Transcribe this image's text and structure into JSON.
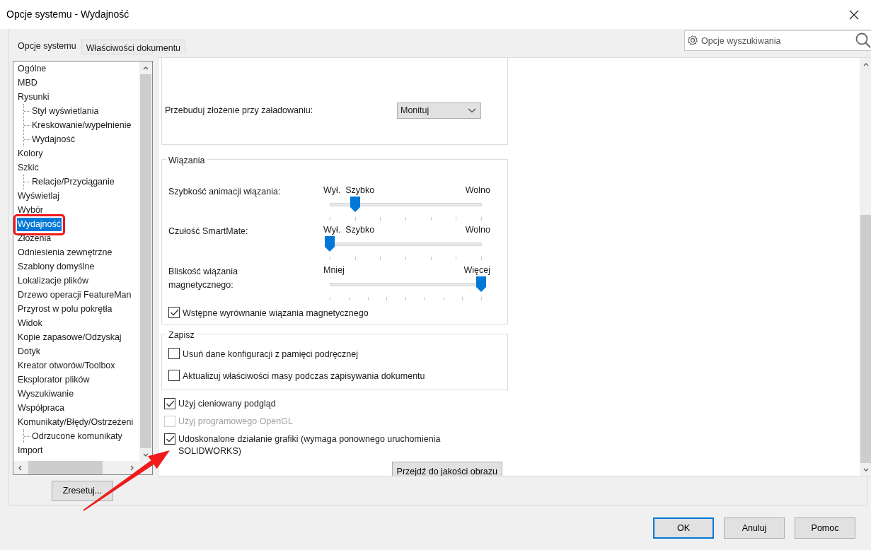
{
  "window": {
    "title": "Opcje systemu - Wydajność"
  },
  "tabs": [
    {
      "label": "Opcje systemu",
      "selected": true
    },
    {
      "label": "Właściwości dokumentu",
      "selected": false
    }
  ],
  "tree": [
    {
      "label": "Ogólne",
      "selected": false,
      "highlighted": false
    },
    {
      "label": "MBD",
      "selected": false,
      "highlighted": false
    },
    {
      "label": "Rysunki",
      "selected": false,
      "highlighted": false,
      "children": [
        {
          "label": "Styl wyświetlania",
          "selected": false,
          "highlighted": false
        },
        {
          "label": "Kreskowanie/wypełnienie",
          "selected": false,
          "highlighted": false
        },
        {
          "label": "Wydajność",
          "selected": false,
          "highlighted": false
        }
      ]
    },
    {
      "label": "Kolory",
      "selected": false,
      "highlighted": false
    },
    {
      "label": "Szkic",
      "selected": false,
      "highlighted": false,
      "children": [
        {
          "label": "Relacje/Przyciąganie",
          "selected": false,
          "highlighted": false
        }
      ]
    },
    {
      "label": "Wyświetlaj",
      "selected": false,
      "highlighted": false
    },
    {
      "label": "Wybór",
      "selected": false,
      "highlighted": false
    },
    {
      "label": "Wydajność",
      "selected": true,
      "highlighted": true
    },
    {
      "label": "Złożenia",
      "selected": false,
      "highlighted": false
    },
    {
      "label": "Odniesienia zewnętrzne",
      "selected": false,
      "highlighted": false
    },
    {
      "label": "Szablony domyślne",
      "selected": false,
      "highlighted": false
    },
    {
      "label": "Lokalizacje plików",
      "selected": false,
      "highlighted": false
    },
    {
      "label": "Drzewo operacji FeatureMan",
      "selected": false,
      "highlighted": false
    },
    {
      "label": "Przyrost w polu pokrętła",
      "selected": false,
      "highlighted": false
    },
    {
      "label": "Widok",
      "selected": false,
      "highlighted": false
    },
    {
      "label": "Kopie zapasowe/Odzyskaj",
      "selected": false,
      "highlighted": false
    },
    {
      "label": "Dotyk",
      "selected": false,
      "highlighted": false
    },
    {
      "label": "Kreator otworów/Toolbox",
      "selected": false,
      "highlighted": false
    },
    {
      "label": "Eksplorator plików",
      "selected": false,
      "highlighted": false
    },
    {
      "label": "Wyszukiwanie",
      "selected": false,
      "highlighted": false
    },
    {
      "label": "Współpraca",
      "selected": false,
      "highlighted": false
    },
    {
      "label": "Komunikaty/Błędy/Ostrzeżeni",
      "selected": false,
      "highlighted": false,
      "children": [
        {
          "label": "Odrzucone komunikaty",
          "selected": false,
          "highlighted": false
        }
      ]
    },
    {
      "label": "Import",
      "selected": false,
      "highlighted": false
    }
  ],
  "reset_button": "Zresetuj...",
  "search": {
    "placeholder": "Opcje wyszukiwania"
  },
  "rebuild": {
    "label": "Przebuduj złożenie przy załadowaniu:",
    "value": "Monituj"
  },
  "mates": {
    "title": "Wiązania",
    "sliders": [
      {
        "kind": "speed",
        "label": "Szybkość animacji wiązania:",
        "marks": [
          "Wył.",
          "Szybko",
          "Wolno"
        ],
        "level": 0.17
      },
      {
        "kind": "speed",
        "label": "Czułość SmartMate:",
        "marks": [
          "Wył.",
          "Szybko",
          "Wolno"
        ],
        "level": 0
      },
      {
        "kind": "proximity",
        "label": "Bliskość wiązania magnetycznego:",
        "marks": [
          "Mniej",
          "Więcej"
        ],
        "level": 1
      }
    ],
    "checkbox": {
      "label": "Wstępne wyrównanie wiązania magnetycznego",
      "checked": true
    }
  },
  "save": {
    "title": "Zapisz",
    "options": [
      {
        "label": "Usuń dane konfiguracji z pamięci podręcznej",
        "checked": false
      },
      {
        "label": "Aktualizuj właściwości masy podczas zapisywania dokumentu",
        "checked": false
      }
    ]
  },
  "options": [
    {
      "label": "Użyj cieniowany podgląd",
      "checked": true,
      "disabled": false
    },
    {
      "label": "Użyj programowego OpenGL",
      "checked": false,
      "disabled": true
    },
    {
      "label": "Udoskonalone działanie grafiki (wymaga ponownego uruchomienia SOLIDWORKS)",
      "checked": true,
      "disabled": false
    }
  ],
  "image_quality_button": "Przejdź do jakości obrazu",
  "buttons": [
    {
      "label": "OK",
      "default": true
    },
    {
      "label": "Anuluj",
      "default": false
    },
    {
      "label": "Pomoc",
      "default": false
    }
  ],
  "annotation_arrow": true
}
